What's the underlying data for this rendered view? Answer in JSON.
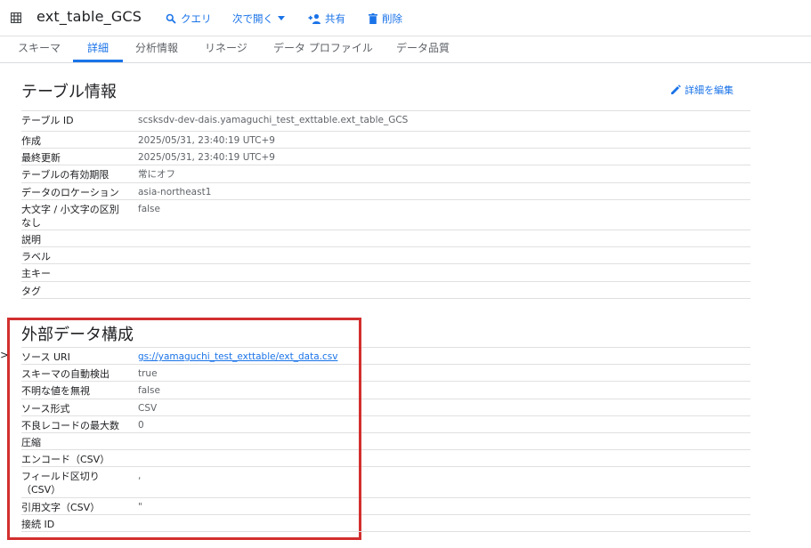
{
  "toolbar": {
    "table_icon": "table-grid-icon",
    "title": "ext_table_GCS",
    "query_label": "クエリ",
    "open_label": "次で開く",
    "share_label": "共有",
    "delete_label": "削除"
  },
  "tabs": [
    "スキーマ",
    "詳細",
    "分析情報",
    "リネージ",
    "データ プロファイル",
    "データ品質"
  ],
  "active_tab": "詳細",
  "table_info": {
    "title": "テーブル情報",
    "edit_label": "詳細を編集",
    "rows": [
      {
        "label": "テーブル ID",
        "value": "scsksdv-dev-dais.yamaguchi_test_exttable.ext_table_GCS"
      },
      {
        "label": "作成",
        "value": "2025/05/31, 23:40:19 UTC+9"
      },
      {
        "label": "最終更新",
        "value": "2025/05/31, 23:40:19 UTC+9"
      },
      {
        "label": "テーブルの有効期限",
        "value": "常にオフ"
      },
      {
        "label": "データのロケーション",
        "value": "asia-northeast1"
      },
      {
        "label": "大文字 / 小文字の区別なし",
        "value": "false"
      },
      {
        "label": "説明",
        "value": ""
      },
      {
        "label": "ラベル",
        "value": ""
      },
      {
        "label": "主キー",
        "value": ""
      },
      {
        "label": "タグ",
        "value": ""
      }
    ]
  },
  "external_config": {
    "title": "外部データ構成",
    "rows": [
      {
        "label": "ソース URI",
        "value": "gs://yamaguchi_test_exttable/ext_data.csv"
      },
      {
        "label": "スキーマの自動検出",
        "value": "true"
      },
      {
        "label": "不明な値を無視",
        "value": "false"
      },
      {
        "label": "ソース形式",
        "value": "CSV"
      },
      {
        "label": "不良レコードの最大数",
        "value": "0"
      },
      {
        "label": "圧縮",
        "value": ""
      },
      {
        "label": "エンコード（CSV）",
        "value": ""
      },
      {
        "label": "フィールド区切り（CSV）",
        "value": ","
      },
      {
        "label": "引用文字（CSV）",
        "value": "\""
      },
      {
        "label": "接続 ID",
        "value": ""
      }
    ]
  },
  "left_edge_mark": ">",
  "colors": {
    "accent": "#1a73e8",
    "highlight": "#d32f2f",
    "divider": "#e0e0e0"
  }
}
